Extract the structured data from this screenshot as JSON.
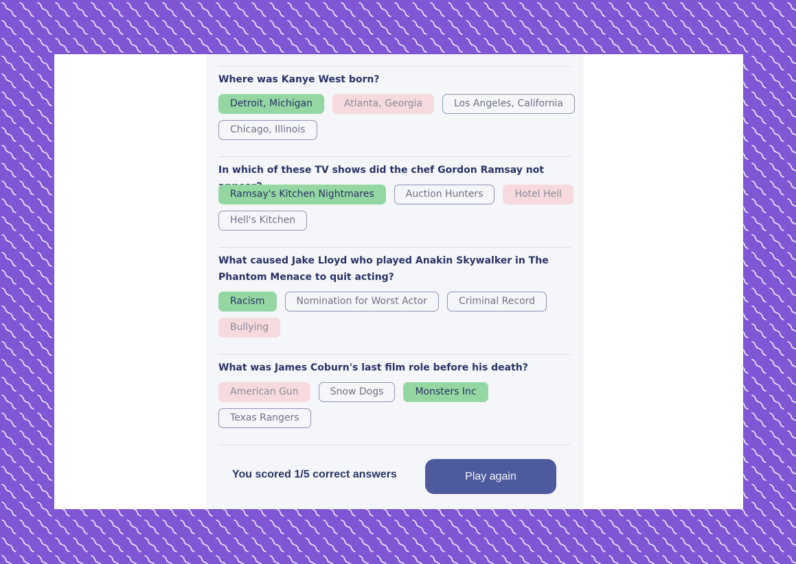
{
  "colors": {
    "background_purple": "#7f56d4",
    "card_background": "#f5f6fa",
    "text_navy": "#293264",
    "correct_green": "#94d7a2",
    "wrong_pink": "#f6dadd",
    "button_blue": "#4d5b9e"
  },
  "questions": [
    {
      "text": "Where was Kanye West born?",
      "answers": [
        {
          "label": "Detroit, Michigan",
          "state": "correct"
        },
        {
          "label": "Atlanta, Georgia",
          "state": "wrong"
        },
        {
          "label": "Los Angeles, California",
          "state": "neutral"
        },
        {
          "label": "Chicago, Illinois",
          "state": "neutral"
        }
      ]
    },
    {
      "text": "In which of these TV shows did the chef Gordon Ramsay not appear?",
      "answers": [
        {
          "label": "Ramsay's Kitchen Nightmares",
          "state": "correct"
        },
        {
          "label": "Auction Hunters",
          "state": "neutral"
        },
        {
          "label": "Hotel Hell",
          "state": "wrong"
        },
        {
          "label": "Hell's Kitchen",
          "state": "neutral"
        }
      ]
    },
    {
      "text": "What caused Jake Lloyd who played Anakin Skywalker in The Phantom Menace to quit acting?",
      "answers": [
        {
          "label": "Racism",
          "state": "correct"
        },
        {
          "label": "Nomination for Worst Actor",
          "state": "neutral"
        },
        {
          "label": "Criminal Record",
          "state": "neutral"
        },
        {
          "label": "Bullying",
          "state": "wrong"
        }
      ]
    },
    {
      "text": "What was James Coburn's last film role before his death?",
      "answers": [
        {
          "label": "American Gun",
          "state": "wrong"
        },
        {
          "label": "Snow Dogs",
          "state": "neutral"
        },
        {
          "label": "Monsters Inc",
          "state": "correct"
        },
        {
          "label": "Texas Rangers",
          "state": "neutral"
        }
      ]
    }
  ],
  "footer": {
    "score_text": "You scored 1/5 correct answers",
    "play_again_label": "Play again"
  }
}
